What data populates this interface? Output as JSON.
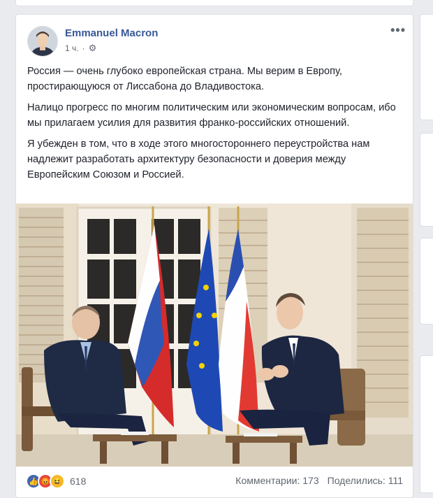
{
  "post": {
    "author": "Emmanuel Macron",
    "time": "1 ч.",
    "more": "•••",
    "paragraphs": [
      "Россия — очень глубоко европейская страна. Мы верим в Европу, простирающуюся от Лиссабона до Владивостока.",
      "Налицо прогресс по многим политическим или экономическим вопросам, ибо мы прилагаем усилия для развития франко-российских отношений.",
      "Я убежден в том, что в ходе этого многостороннего переустройства нам надлежит разработать архитектуру безопасности и доверия между Европейским Союзом и Россией."
    ]
  },
  "footer": {
    "reaction_count": "618",
    "comments": "Комментарии: 173",
    "shares": "Поделились: 111"
  },
  "icons": {
    "privacy": "gear-icon",
    "reactions": [
      "like-icon",
      "angry-icon",
      "haha-icon"
    ]
  },
  "colors": {
    "author_link": "#385898",
    "like": "#4267b2",
    "angry": "#e4463f",
    "haha": "#f7b928"
  }
}
